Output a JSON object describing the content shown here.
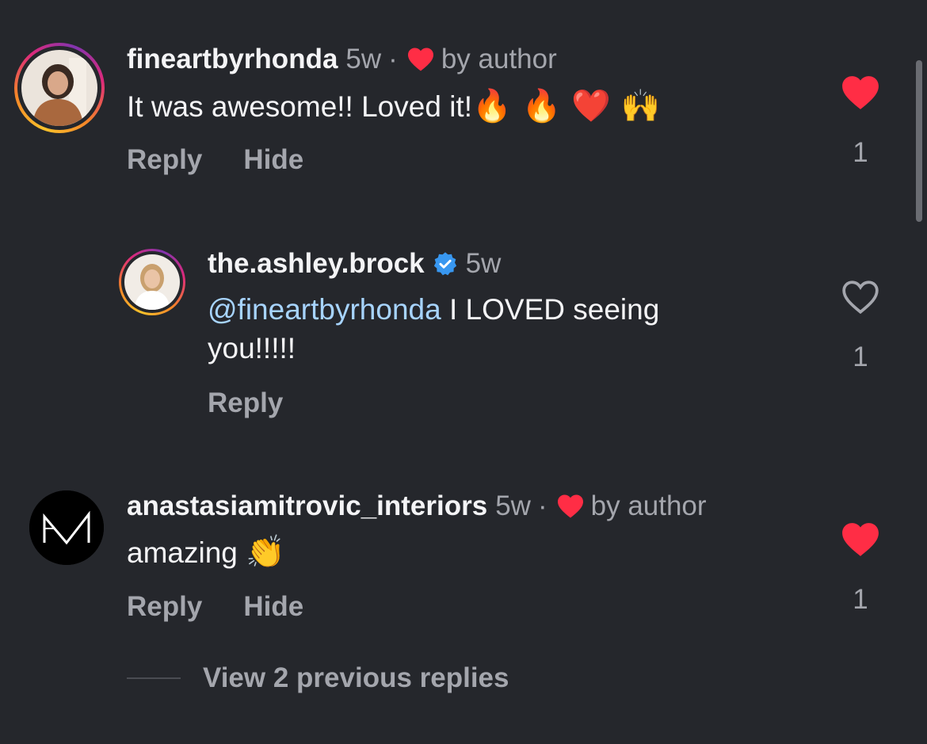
{
  "comments": [
    {
      "username": "fineartbyrhonda",
      "time": "5w",
      "dot": "·",
      "by_author": "by author",
      "text": "It was awesome!! Loved it!",
      "emojis": "🔥 🔥 ❤️ 🙌",
      "reply_label": "Reply",
      "hide_label": "Hide",
      "like_count": "1",
      "liked": true,
      "avatar_icon": "woman-portrait-icon"
    },
    {
      "username": "the.ashley.brock",
      "time": "5w",
      "mention": "@fineartbyrhonda",
      "text_line1": " I LOVED seeing",
      "text_line2": "you!!!!!",
      "reply_label": "Reply",
      "like_count": "1",
      "liked": false,
      "avatar_icon": "woman-portrait-icon"
    },
    {
      "username": "anastasiamitrovic_interiors",
      "time": "5w",
      "dot": "·",
      "by_author": "by author",
      "text": "amazing",
      "emojis": "👏",
      "reply_label": "Reply",
      "hide_label": "Hide",
      "like_count": "1",
      "liked": true,
      "avatar_icon": "monogram-logo-icon"
    }
  ],
  "view_replies": "View 2 previous replies",
  "colors": {
    "background": "#25272c",
    "heart_red": "#ff2d45",
    "mention_blue": "#a7d4ff",
    "verified_blue": "#3897f0",
    "muted": "#a4a6ad"
  }
}
